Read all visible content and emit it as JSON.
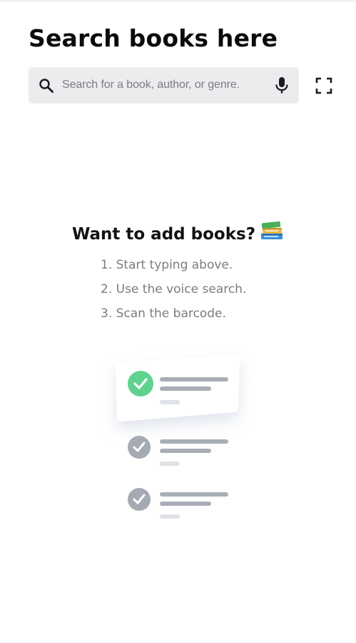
{
  "header": {
    "title": "Search books here"
  },
  "search": {
    "placeholder": "Search for a book, author, or genre.",
    "icons": [
      "search-icon",
      "mic-icon",
      "barcode-scan-icon"
    ]
  },
  "empty_state": {
    "heading": "Want to add books?",
    "heading_emoji": "books-emoji",
    "steps": [
      "1. Start typing above.",
      "2. Use the voice search.",
      "3. Scan the barcode."
    ]
  },
  "illustration": {
    "items": [
      {
        "state": "checked",
        "color": "#5fd38d"
      },
      {
        "state": "checked",
        "color": "#a5aab3"
      },
      {
        "state": "checked",
        "color": "#a5aab3"
      }
    ],
    "line_color": "#a8adb6",
    "faint_line_color": "#dfe2e6"
  },
  "colors": {
    "background": "#ffffff",
    "search_bg": "#ececee",
    "title_text": "#0b0b0d",
    "muted_text": "#7a7c80",
    "accent_green": "#5fd38d"
  }
}
